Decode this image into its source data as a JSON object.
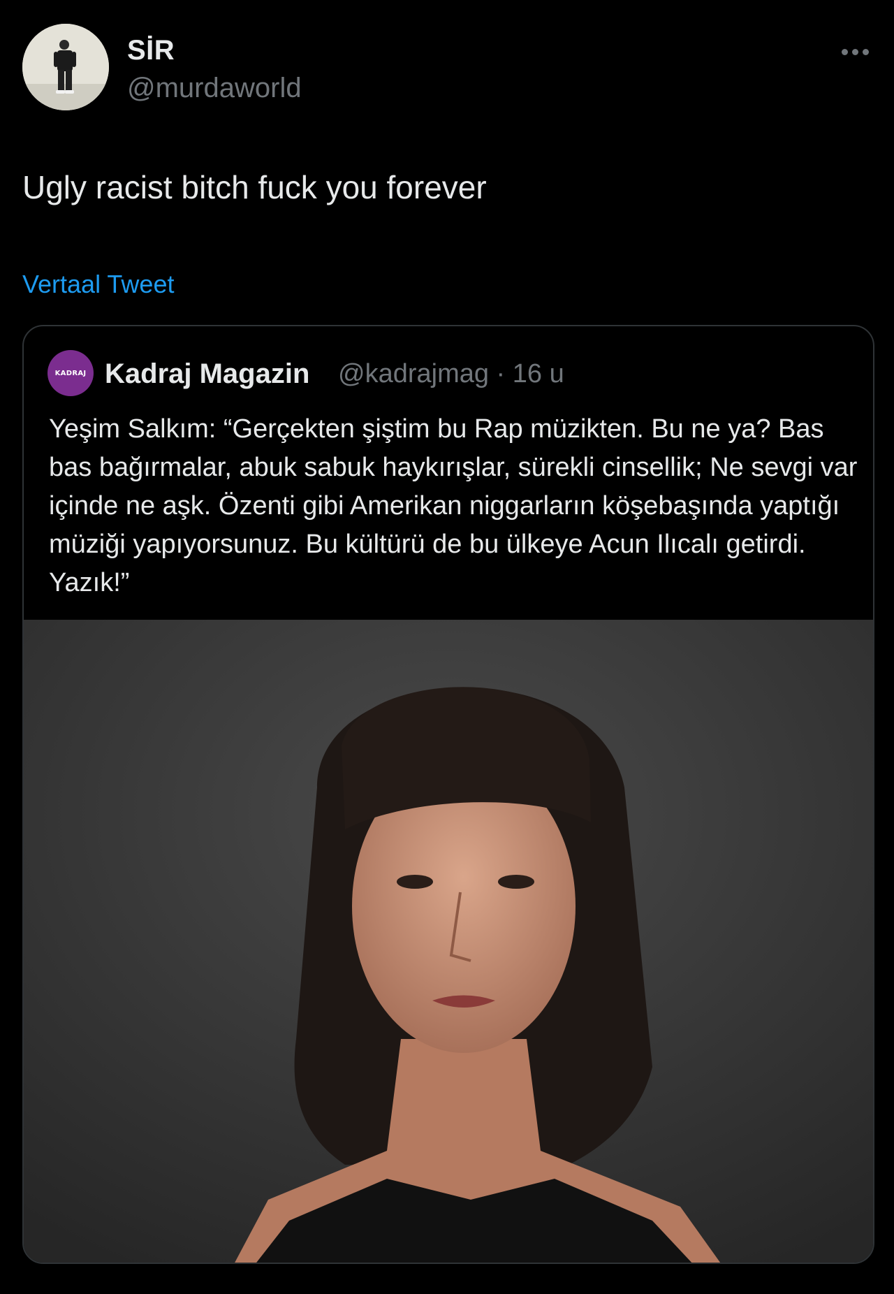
{
  "tweet": {
    "author": {
      "display_name": "SİR",
      "handle": "@murdaworld"
    },
    "text": "Ugly racist bitch fuck you forever",
    "translate_label": "Vertaal Tweet",
    "more_icon": "more-icon"
  },
  "quoted_tweet": {
    "author": {
      "avatar_text": "KADRAJ",
      "display_name": "Kadraj Magazin",
      "handle": "@kadrajmag",
      "time": "16 u"
    },
    "text": "Yeşim Salkım: “Gerçekten şiştim bu Rap müzikten. Bu ne ya? Bas bas bağırmalar, abuk sabuk haykırışlar, sürekli cinsellik; Ne sevgi var içinde ne aşk. Özenti gibi Amerikan niggarların köşebaşında yaptığı müziği yapıyorsunuz. Bu kültürü de bu ülkeye Acun Ilıcalı getirdi. Yazık!”"
  },
  "colors": {
    "background": "#000000",
    "text_primary": "#e7e9ea",
    "text_secondary": "#71767b",
    "link": "#1d9bf0",
    "border": "#2f3336",
    "quote_avatar_bg": "#7b2d8f"
  }
}
